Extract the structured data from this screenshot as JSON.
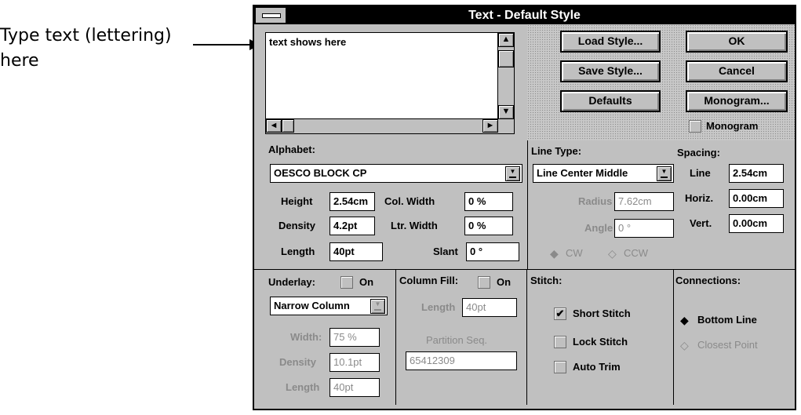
{
  "annotation": {
    "text": "Type text (lettering) here"
  },
  "window": {
    "title": "Text - Default Style"
  },
  "text_area": {
    "value": "text shows here"
  },
  "buttons": {
    "load_style": "Load Style...",
    "save_style": "Save Style...",
    "defaults": "Defaults",
    "ok": "OK",
    "cancel": "Cancel",
    "monogram": "Monogram..."
  },
  "monogram_checkbox": {
    "label": "Monogram",
    "checked": false
  },
  "alphabet": {
    "label": "Alphabet:",
    "value": "OESCO BLOCK CP",
    "height_label": "Height",
    "height": "2.54cm",
    "density_label": "Density",
    "density": "4.2pt",
    "length_label": "Length",
    "length": "40pt",
    "col_width_label": "Col. Width",
    "col_width": "0 %",
    "ltr_width_label": "Ltr. Width",
    "ltr_width": "0 %",
    "slant_label": "Slant",
    "slant": "0 °"
  },
  "line_type": {
    "label": "Line Type:",
    "value": "Line Center Middle",
    "radius_label": "Radius",
    "radius": "7.62cm",
    "angle_label": "Angle",
    "angle": "0 °",
    "cw_label": "CW",
    "ccw_label": "CCW"
  },
  "spacing": {
    "label": "Spacing:",
    "line_label": "Line",
    "line": "2.54cm",
    "horiz_label": "Horiz.",
    "horiz": "0.00cm",
    "vert_label": "Vert.",
    "vert": "0.00cm"
  },
  "underlay": {
    "label": "Underlay:",
    "on_label": "On",
    "type": "Narrow Column",
    "width_label": "Width:",
    "width": "75 %",
    "density_label": "Density",
    "density": "10.1pt",
    "length_label": "Length",
    "length": "40pt"
  },
  "column_fill": {
    "label": "Column Fill:",
    "on_label": "On",
    "length_label": "Length",
    "length": "40pt",
    "partition_label": "Partition Seq.",
    "partition": "65412309"
  },
  "stitch": {
    "label": "Stitch:",
    "short_stitch": "Short Stitch",
    "short_checked": true,
    "lock_stitch": "Lock Stitch",
    "auto_trim": "Auto Trim"
  },
  "connections": {
    "label": "Connections:",
    "bottom_line": "Bottom Line",
    "closest_point": "Closest Point"
  },
  "icons": {
    "up": "▲",
    "down": "▼",
    "left": "◄",
    "right": "►",
    "check": "✔",
    "radio_on": "◆",
    "radio_off": "◇"
  }
}
